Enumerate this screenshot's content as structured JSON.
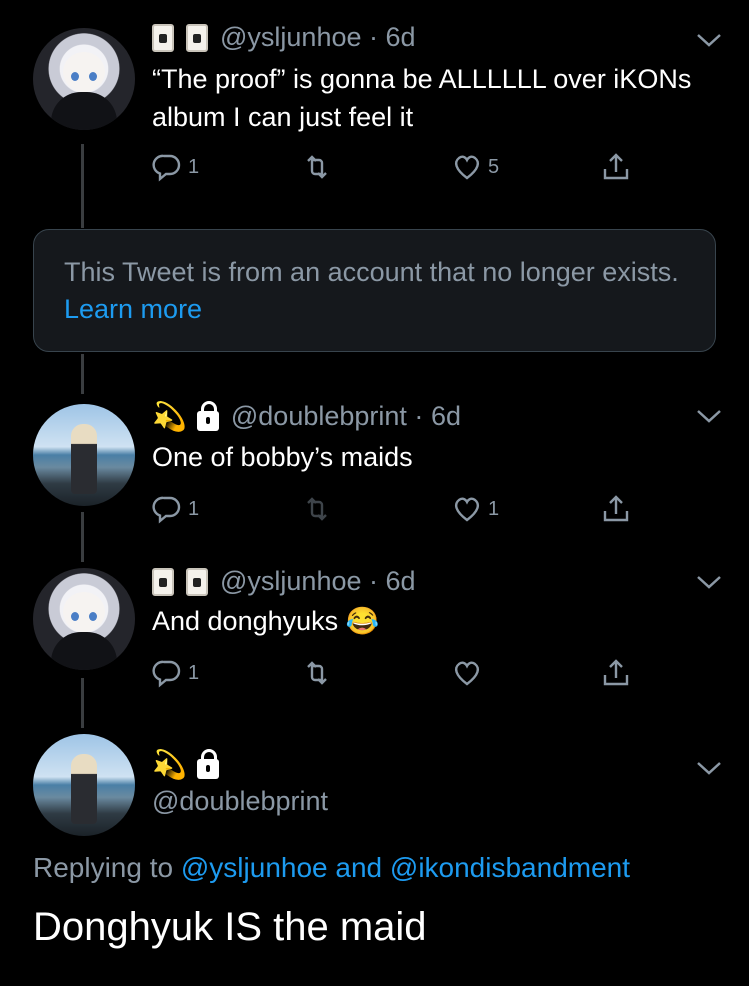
{
  "tweets": [
    {
      "handle": "@ysljunhoe",
      "sep": "·",
      "age": "6d",
      "text": "“The proof” is gonna be ALLLLLL over iKONs album I can just feel it",
      "replies": "1",
      "likes": "5"
    },
    {
      "handle": "@doublebprint",
      "sep": "·",
      "age": "6d",
      "text": "One of bobby’s maids",
      "replies": "1",
      "likes": "1"
    },
    {
      "handle": "@ysljunhoe",
      "sep": "·",
      "age": "6d",
      "text": "And donghyuks 😂",
      "replies": "1",
      "likes": ""
    }
  ],
  "notice": {
    "text": "This Tweet is from an account that no longer exists.",
    "link": "Learn more"
  },
  "focused": {
    "handle": "@doublebprint",
    "replying_prefix": "Replying to",
    "replying_user1": "@ysljunhoe",
    "replying_and": "and",
    "replying_user2": "@ikondisbandment",
    "text": "Donghyuk IS the maid"
  },
  "icons": [
    "reply-icon",
    "retweet-icon",
    "like-icon",
    "share-icon",
    "chevron-down-icon",
    "lock-icon",
    "dizzy-emoji",
    "card-emoji"
  ],
  "colors": {
    "background": "#000000",
    "secondary": "#8b98a5",
    "link": "#1d9bf0",
    "border": "#38444d"
  }
}
